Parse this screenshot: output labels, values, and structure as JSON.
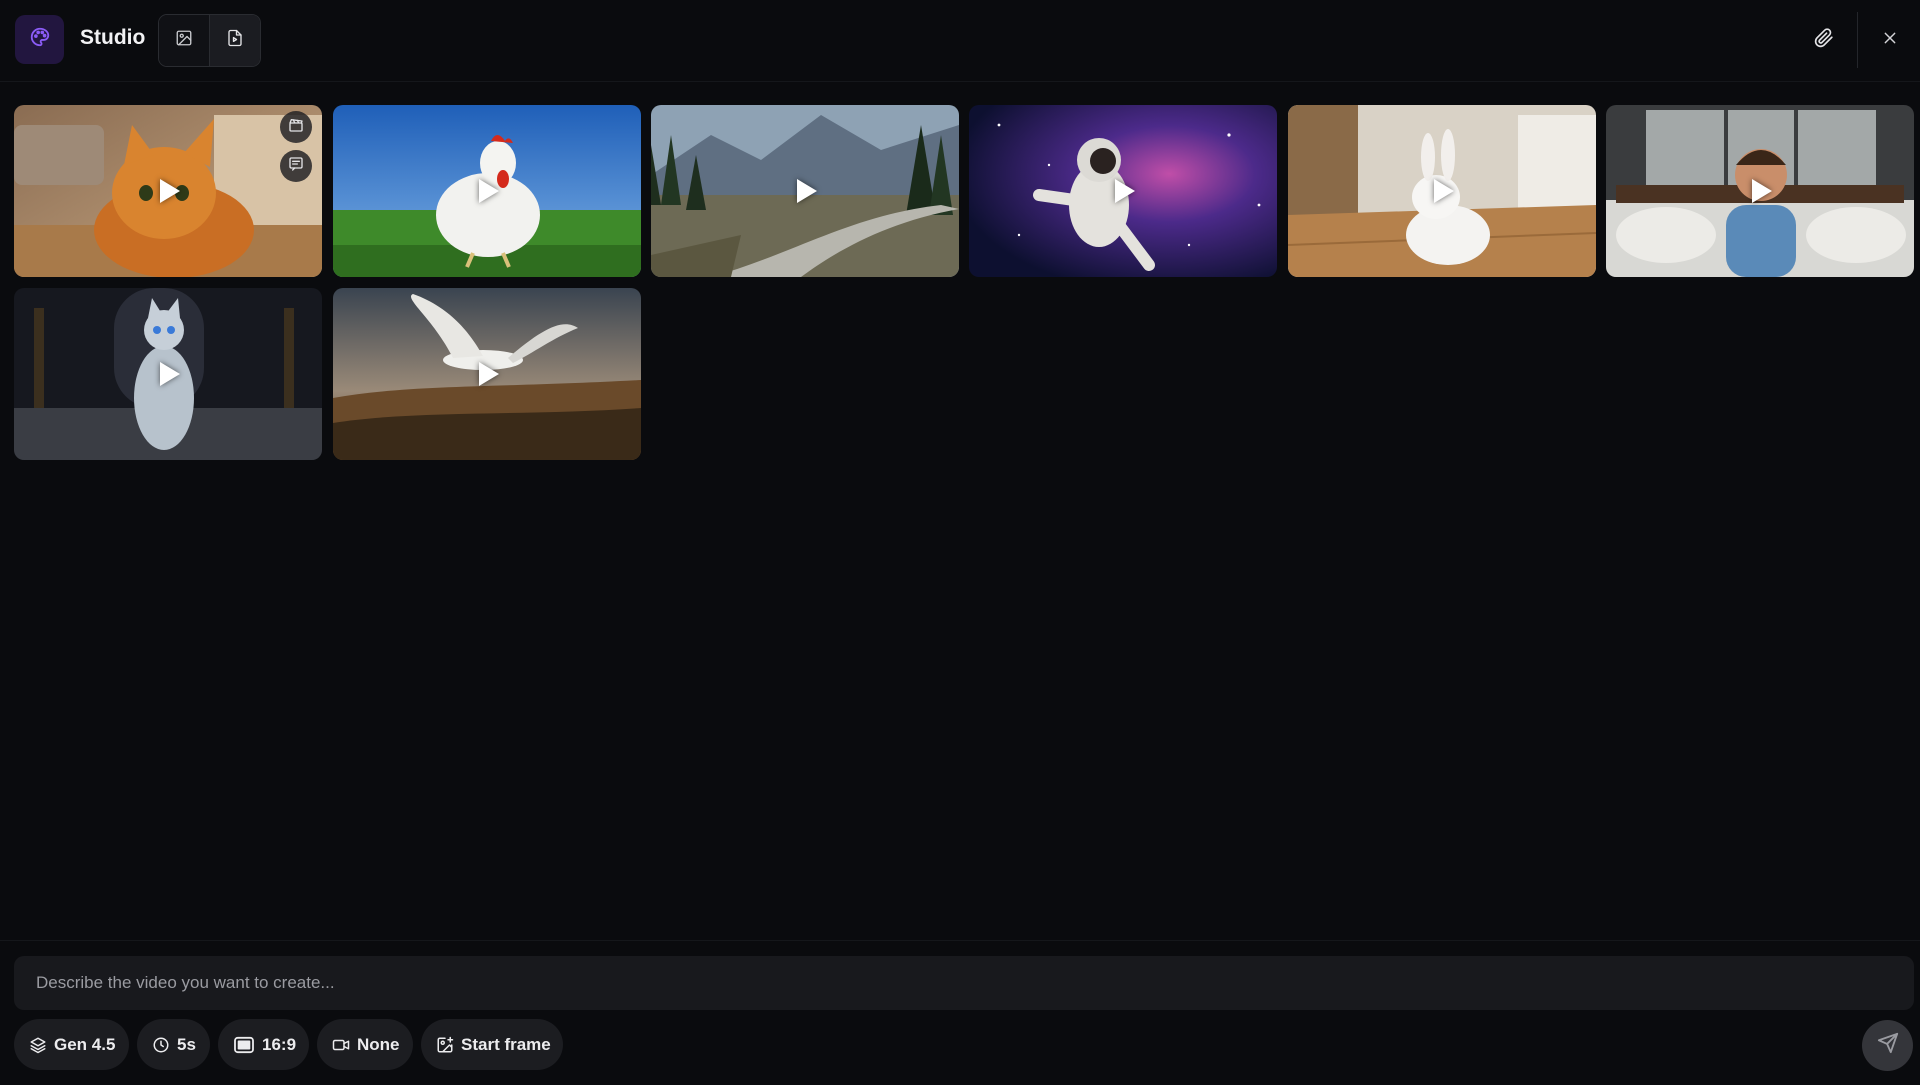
{
  "app": {
    "title": "Studio",
    "logo_icon": "palette-icon",
    "accent": "#7b4fe0"
  },
  "header": {
    "modes": [
      {
        "name": "image-mode",
        "icon": "image-icon",
        "active": false
      },
      {
        "name": "video-mode",
        "icon": "video-file-icon",
        "active": true
      }
    ],
    "actions": [
      {
        "icon": "paperclip-icon"
      },
      {
        "icon": "close-icon"
      }
    ]
  },
  "gallery": {
    "videos": [
      {
        "subject": "cat",
        "tile_actions": [
          "clapperboard-icon",
          "message-icon"
        ]
      },
      {
        "subject": "rooster"
      },
      {
        "subject": "mountain-road"
      },
      {
        "subject": "astronaut"
      },
      {
        "subject": "rabbit"
      },
      {
        "subject": "boy-in-bed"
      },
      {
        "subject": "crystal-cat"
      },
      {
        "subject": "bird-over-forest"
      }
    ]
  },
  "composer": {
    "placeholder": "Describe the video you want to create...",
    "options": {
      "model": {
        "label": "Gen 4.5",
        "icon": "layers-icon"
      },
      "duration": {
        "label": "5s",
        "icon": "clock-icon"
      },
      "aspect": {
        "label": "16:9",
        "icon": "aspect-ratio-icon"
      },
      "camera": {
        "label": "None",
        "icon": "video-camera-icon"
      },
      "start_frame": {
        "label": "Start frame",
        "icon": "image-plus-icon"
      }
    },
    "send_icon": "send-icon"
  }
}
